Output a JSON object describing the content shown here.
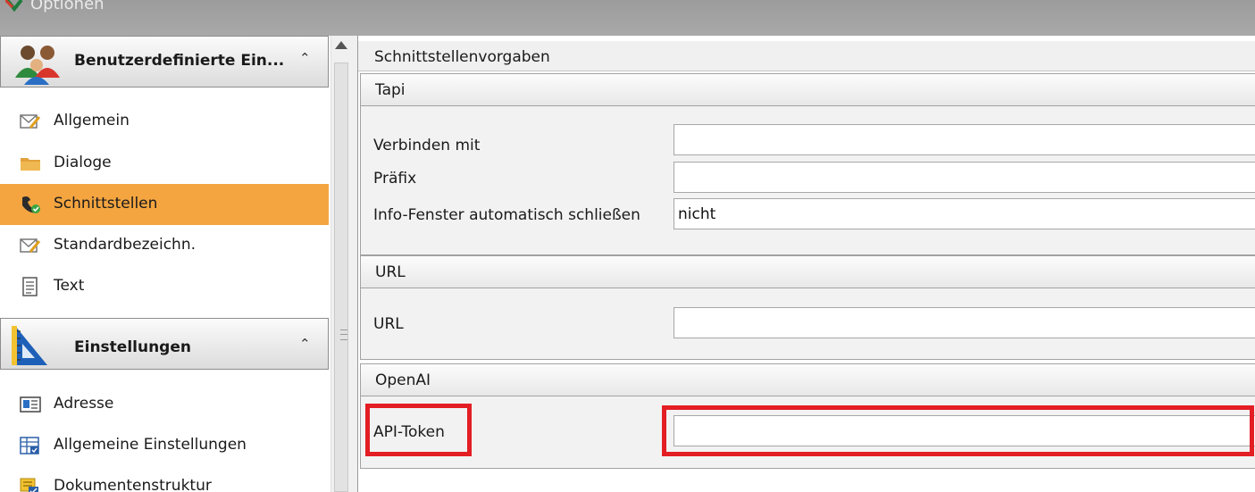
{
  "window": {
    "title": "Optionen"
  },
  "nav": {
    "groups": [
      {
        "label": "Benutzerdefinierte Ein...",
        "icon": "users-icon"
      },
      {
        "label": "Einstellungen",
        "icon": "ruler-triangle-icon"
      }
    ],
    "items": [
      {
        "label": "Allgemein",
        "icon": "edit-envelope-icon"
      },
      {
        "label": "Dialoge",
        "icon": "folder-icon"
      },
      {
        "label": "Schnittstellen",
        "icon": "phone-check-icon",
        "selected": true
      },
      {
        "label": "Standardbezeichn.",
        "icon": "edit-envelope-icon"
      },
      {
        "label": "Text",
        "icon": "text-document-icon"
      },
      {
        "label": "Adresse",
        "icon": "address-card-icon"
      },
      {
        "label": "Allgemeine Einstellungen",
        "icon": "settings-table-icon"
      },
      {
        "label": "Dokumentenstruktur",
        "icon": "document-structure-icon"
      }
    ]
  },
  "main": {
    "header": "Schnittstellenvorgaben",
    "sections": {
      "tapi": {
        "title": "Tapi",
        "fields": [
          {
            "label": "Verbinden mit",
            "value": ""
          },
          {
            "label": "Präfix",
            "value": ""
          },
          {
            "label": "Info-Fenster automatisch schließen",
            "value": "nicht"
          }
        ]
      },
      "url": {
        "title": "URL",
        "fields": [
          {
            "label": "URL",
            "value": ""
          }
        ]
      },
      "openai": {
        "title": "OpenAI",
        "fields": [
          {
            "label": "API-Token",
            "value": ""
          }
        ]
      }
    }
  },
  "colors": {
    "selected": "#f4a540",
    "highlight": "#e31e24"
  }
}
